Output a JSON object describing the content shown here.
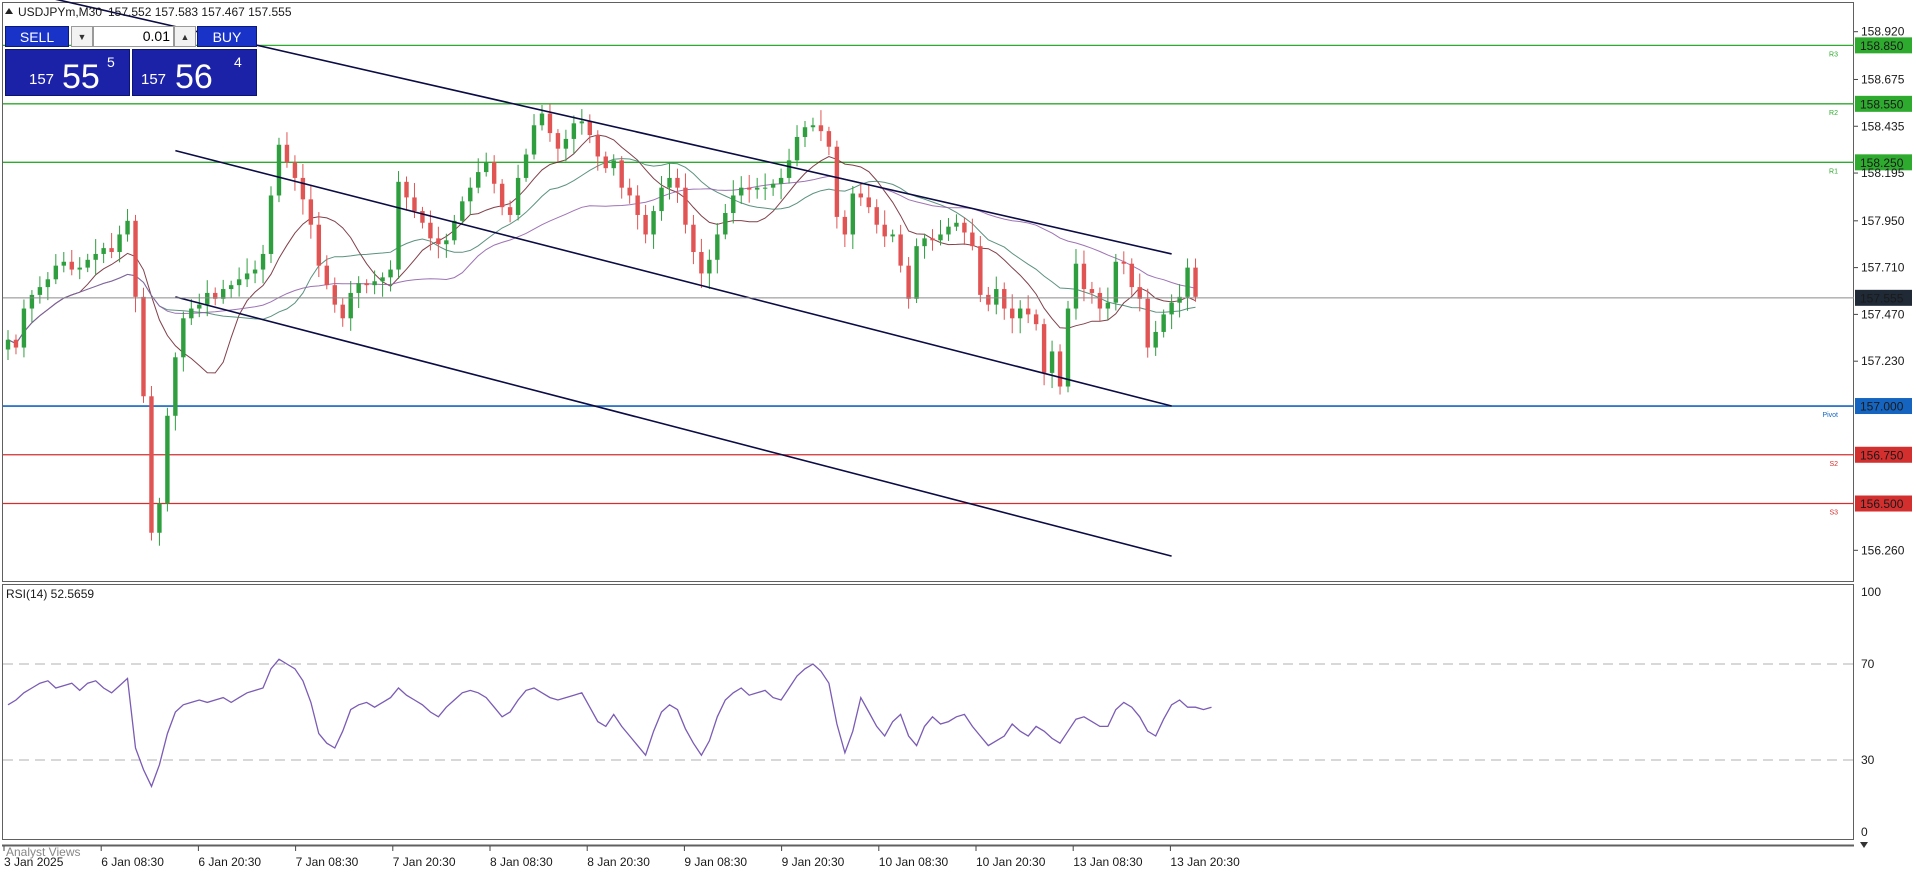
{
  "header": {
    "symbol_timeframe": "USDJPYm,M30",
    "ohlc": "157.552 157.583 157.467 157.555"
  },
  "trade_panel": {
    "sell_label": "SELL",
    "buy_label": "BUY",
    "lot": "0.01",
    "sell_price": {
      "prefix": "157",
      "big": "55",
      "sup": "5"
    },
    "buy_price": {
      "prefix": "157",
      "big": "56",
      "sup": "4"
    }
  },
  "colors": {
    "resistance": "#2eaa2e",
    "pivot": "#1565c0",
    "support": "#d32f2f",
    "bull": "#2e9e3e",
    "bear": "#e15454",
    "channel": "#0b0b45",
    "rsi": "#7a5bb5",
    "ma_fast": "#6b1f2a",
    "ma_mid": "#3f7f68",
    "ma_slow": "#8d5aa8"
  },
  "current_price": "157.555",
  "footer_text": "Analyst Views",
  "chart_data": [
    {
      "type": "candlestick",
      "symbol": "USDJPYm",
      "timeframe": "M30",
      "ylim": [
        156.2,
        158.98
      ],
      "y_ticks": [
        "158.920",
        "158.675",
        "158.435",
        "158.195",
        "157.950",
        "157.710",
        "157.470",
        "157.230",
        "156.260"
      ],
      "x_ticks": [
        "3 Jan 2025",
        "6 Jan 08:30",
        "6 Jan 20:30",
        "7 Jan 08:30",
        "7 Jan 20:30",
        "8 Jan 08:30",
        "8 Jan 20:30",
        "9 Jan 08:30",
        "9 Jan 20:30",
        "10 Jan 08:30",
        "10 Jan 20:30",
        "13 Jan 08:30",
        "13 Jan 20:30"
      ],
      "levels": [
        {
          "name": "R3",
          "value": 158.85,
          "label": "158.850",
          "kind": "resistance"
        },
        {
          "name": "R2",
          "value": 158.55,
          "label": "158.550",
          "kind": "resistance"
        },
        {
          "name": "R1",
          "value": 158.25,
          "label": "158.250",
          "kind": "resistance"
        },
        {
          "name": "Pivot",
          "value": 157.0,
          "label": "157.000",
          "kind": "pivot"
        },
        {
          "name": "S2",
          "value": 156.75,
          "label": "156.750",
          "kind": "support"
        },
        {
          "name": "S3",
          "value": 156.5,
          "label": "156.500",
          "kind": "support"
        }
      ],
      "channel_lines": [
        [
          [
            -3,
            159.17
          ],
          [
            146,
            157.78
          ]
        ],
        [
          [
            21,
            158.31
          ],
          [
            146,
            157.0
          ]
        ],
        [
          [
            21,
            157.56
          ],
          [
            146,
            156.23
          ]
        ]
      ],
      "closes": [
        157.34,
        157.3,
        157.5,
        157.57,
        157.61,
        157.65,
        157.72,
        157.74,
        157.7,
        157.71,
        157.75,
        157.78,
        157.81,
        157.79,
        157.88,
        157.95,
        157.56,
        157.05,
        156.35,
        156.5,
        156.95,
        157.25,
        157.45,
        157.5,
        157.52,
        157.58,
        157.55,
        157.6,
        157.62,
        157.65,
        157.68,
        157.7,
        157.78,
        158.08,
        158.34,
        158.25,
        158.17,
        158.06,
        157.93,
        157.72,
        157.62,
        157.52,
        157.45,
        157.58,
        157.63,
        157.62,
        157.64,
        157.66,
        157.7,
        158.15,
        158.07,
        158.0,
        157.94,
        157.86,
        157.83,
        157.85,
        157.95,
        158.05,
        158.12,
        158.2,
        158.25,
        158.14,
        158.02,
        157.98,
        158.17,
        158.29,
        158.44,
        158.5,
        158.4,
        158.32,
        158.37,
        158.45,
        158.46,
        158.39,
        158.28,
        158.22,
        158.26,
        158.12,
        158.08,
        157.98,
        157.88,
        158.0,
        158.12,
        158.17,
        158.12,
        157.93,
        157.79,
        157.68,
        157.75,
        157.88,
        157.99,
        158.08,
        158.12,
        158.11,
        158.12,
        158.12,
        158.14,
        158.17,
        158.26,
        158.38,
        158.43,
        158.44,
        158.41,
        158.33,
        157.97,
        157.88,
        158.09,
        158.07,
        158.02,
        157.93,
        157.87,
        157.88,
        157.72,
        157.55,
        157.82,
        157.86,
        157.85,
        157.88,
        157.92,
        157.94,
        157.89,
        157.82,
        157.57,
        157.52,
        157.6,
        157.5,
        157.45,
        157.5,
        157.47,
        157.42,
        157.17,
        157.28,
        157.1,
        157.5,
        157.73,
        157.6,
        157.58,
        157.5,
        157.53,
        157.74,
        157.73,
        157.61,
        157.55,
        157.3,
        157.38,
        157.47,
        157.53,
        157.56,
        157.71,
        157.56
      ]
    },
    {
      "type": "line",
      "title": "RSI(14) 52.5659",
      "name": "RSI(14)",
      "ylim": [
        0,
        100
      ],
      "y_ticks": [
        "100",
        "70",
        "30",
        "0"
      ],
      "levels": [
        70,
        30
      ],
      "values": [
        53,
        55,
        58,
        60,
        62,
        63,
        60,
        61,
        62,
        59,
        62,
        63,
        60,
        58,
        61,
        64,
        35,
        26,
        19,
        28,
        41,
        50,
        53,
        54,
        55,
        54,
        55,
        56,
        54,
        56,
        58,
        59,
        60,
        68,
        72,
        70,
        68,
        63,
        54,
        41,
        37,
        35,
        42,
        51,
        53,
        54,
        52,
        54,
        56,
        60,
        57,
        55,
        53,
        50,
        48,
        52,
        55,
        58,
        59,
        58,
        56,
        52,
        48,
        50,
        55,
        59,
        60,
        58,
        56,
        55,
        56,
        57,
        58,
        52,
        46,
        44,
        49,
        44,
        40,
        36,
        32,
        42,
        50,
        53,
        51,
        43,
        37,
        32,
        38,
        48,
        55,
        58,
        60,
        57,
        58,
        59,
        56,
        55,
        60,
        65,
        68,
        70,
        67,
        62,
        45,
        33,
        42,
        56,
        50,
        44,
        40,
        46,
        49,
        40,
        36,
        44,
        48,
        45,
        46,
        48,
        49,
        44,
        40,
        36,
        38,
        40,
        45,
        42,
        40,
        44,
        42,
        39,
        37,
        42,
        47,
        48,
        46,
        44,
        44,
        51,
        54,
        52,
        48,
        42,
        40,
        47,
        53,
        55,
        52,
        52,
        51,
        52
      ]
    }
  ]
}
